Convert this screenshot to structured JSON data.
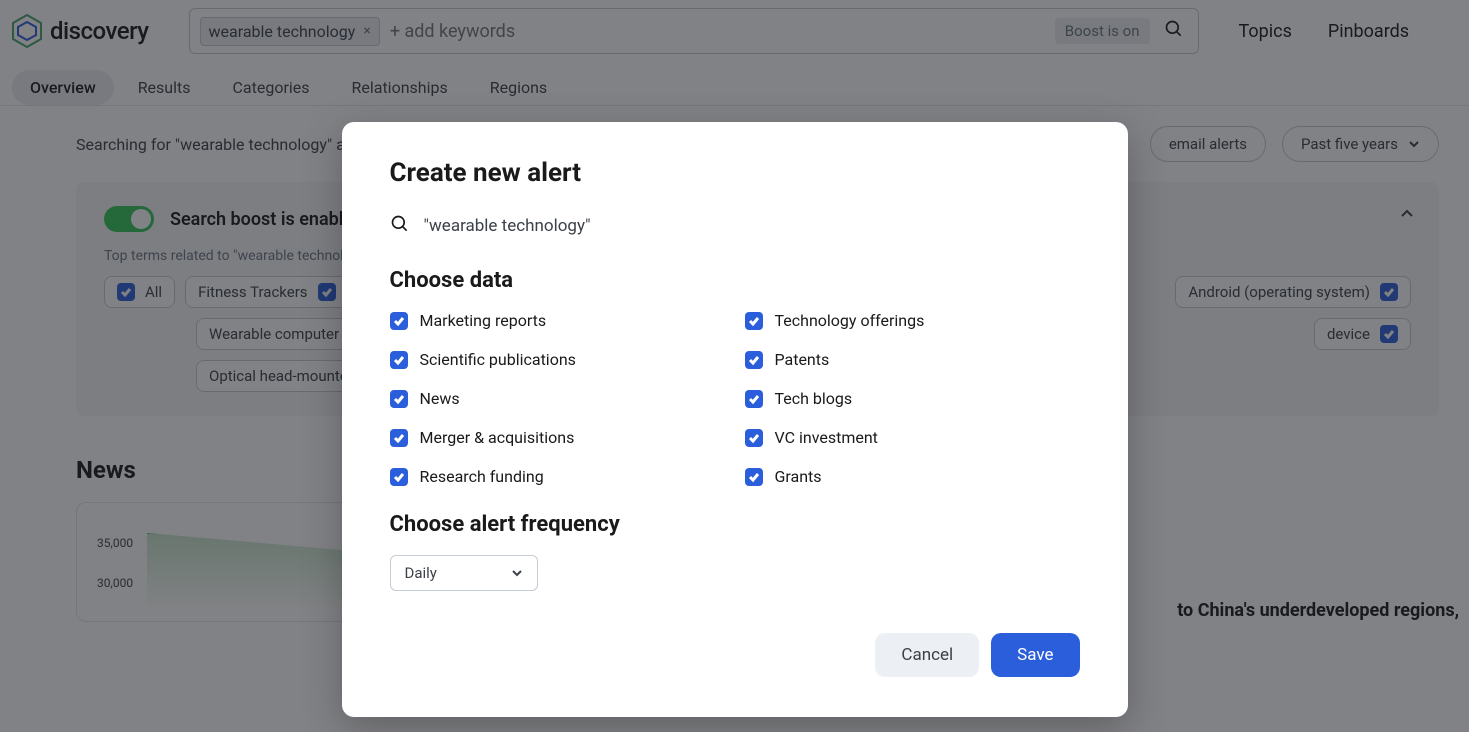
{
  "brand": {
    "name": "discovery"
  },
  "search": {
    "chip": "wearable technology",
    "placeholder": "+ add keywords",
    "boost_badge": "Boost is on"
  },
  "top_nav": {
    "topics": "Topics",
    "pinboards": "Pinboards"
  },
  "tabs": {
    "overview": "Overview",
    "results": "Results",
    "categories": "Categories",
    "relationships": "Relationships",
    "regions": "Regions"
  },
  "searching_text": "Searching for \"wearable technology\" as tex",
  "controls": {
    "email_alerts": "email alerts",
    "date_range": "Past five years"
  },
  "boost_panel": {
    "title": "Search boost is enabled",
    "subtitle": "Top terms related to \"wearable technology\"",
    "term_all": "All",
    "term_fitness": "Fitness Trackers",
    "term_android": "Android (operating system)",
    "term_wearable_computer": "Wearable computer",
    "term_device": "device",
    "term_optical": "Optical head-mounted d"
  },
  "news": {
    "heading": "News",
    "y_35000": "35,000",
    "y_30000": "30,000",
    "article_snippet": "to China's underdeveloped regions,"
  },
  "modal": {
    "title": "Create new alert",
    "query": "\"wearable technology\"",
    "section_data": "Choose data",
    "section_freq": "Choose alert frequency",
    "options": {
      "marketing": "Marketing reports",
      "tech_offerings": "Technology offerings",
      "scientific": "Scientific publications",
      "patents": "Patents",
      "news": "News",
      "tech_blogs": "Tech blogs",
      "merger": "Merger & acquisitions",
      "vc": "VC investment",
      "research": "Research funding",
      "grants": "Grants"
    },
    "frequency": "Daily",
    "cancel": "Cancel",
    "save": "Save"
  },
  "chart_data": {
    "type": "area",
    "series": [
      {
        "name": "News",
        "values": [
          35000,
          33800
        ]
      }
    ],
    "ylim": [
      30000,
      35000
    ],
    "visible_ticks": [
      35000,
      30000
    ]
  }
}
